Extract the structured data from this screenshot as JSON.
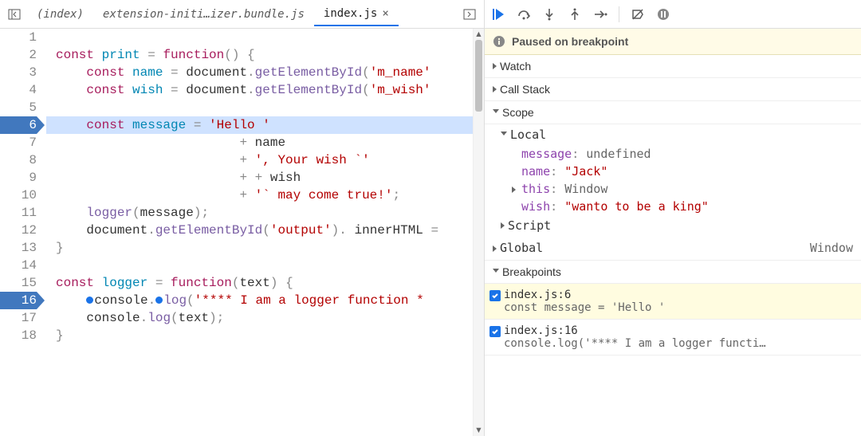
{
  "tabs": {
    "sidebar_toggle_icon": "panel-left-icon",
    "items": [
      {
        "label": "(index)",
        "active": false
      },
      {
        "label": "extension-initi…izer.bundle.js",
        "active": false
      },
      {
        "label": "index.js",
        "active": true
      }
    ],
    "more_tabs_icon": "chevron-right-icon"
  },
  "code": {
    "lines": [
      {
        "n": 1,
        "seg": []
      },
      {
        "n": 2,
        "seg": [
          [
            "kw",
            "const "
          ],
          [
            "var",
            "print"
          ],
          [
            "punct",
            " = "
          ],
          [
            "kw",
            "function"
          ],
          [
            "punct",
            "() {"
          ]
        ]
      },
      {
        "n": 3,
        "seg": [
          [
            "",
            "    "
          ],
          [
            "kw",
            "const "
          ],
          [
            "var",
            "name"
          ],
          [
            "punct",
            " = "
          ],
          [
            "ident",
            "document"
          ],
          [
            "punct",
            "."
          ],
          [
            "fn",
            "getElementById"
          ],
          [
            "punct",
            "("
          ],
          [
            "str",
            "'m_name'"
          ]
        ]
      },
      {
        "n": 4,
        "seg": [
          [
            "",
            "    "
          ],
          [
            "kw",
            "const "
          ],
          [
            "var",
            "wish"
          ],
          [
            "punct",
            " = "
          ],
          [
            "ident",
            "document"
          ],
          [
            "punct",
            "."
          ],
          [
            "fn",
            "getElementById"
          ],
          [
            "punct",
            "("
          ],
          [
            "str",
            "'m_wish'"
          ]
        ]
      },
      {
        "n": 5,
        "seg": []
      },
      {
        "n": 6,
        "bp": true,
        "current": true,
        "seg": [
          [
            "",
            "    "
          ],
          [
            "kw",
            "const "
          ],
          [
            "var",
            "message"
          ],
          [
            "punct",
            " = "
          ],
          [
            "str",
            "'Hello '"
          ]
        ]
      },
      {
        "n": 7,
        "seg": [
          [
            "",
            "                        "
          ],
          [
            "punct",
            "+ "
          ],
          [
            "ident",
            "name"
          ]
        ]
      },
      {
        "n": 8,
        "seg": [
          [
            "",
            "                        "
          ],
          [
            "punct",
            "+ "
          ],
          [
            "str",
            "', Your wish `'"
          ]
        ]
      },
      {
        "n": 9,
        "seg": [
          [
            "",
            "                        "
          ],
          [
            "punct",
            "+ + "
          ],
          [
            "ident",
            "wish"
          ]
        ]
      },
      {
        "n": 10,
        "seg": [
          [
            "",
            "                        "
          ],
          [
            "punct",
            "+ "
          ],
          [
            "str",
            "'` may come true!'"
          ],
          [
            "punct",
            ";"
          ]
        ]
      },
      {
        "n": 11,
        "seg": [
          [
            "",
            "    "
          ],
          [
            "fn",
            "logger"
          ],
          [
            "punct",
            "("
          ],
          [
            "ident",
            "message"
          ],
          [
            "punct",
            ");"
          ]
        ]
      },
      {
        "n": 12,
        "seg": [
          [
            "",
            "    "
          ],
          [
            "ident",
            "document"
          ],
          [
            "punct",
            "."
          ],
          [
            "fn",
            "getElementById"
          ],
          [
            "punct",
            "("
          ],
          [
            "str",
            "'output'"
          ],
          [
            "punct",
            "). "
          ],
          [
            "ident",
            "innerHTML"
          ],
          [
            "punct",
            " ="
          ]
        ]
      },
      {
        "n": 13,
        "seg": [
          [
            "punct",
            "}"
          ]
        ]
      },
      {
        "n": 14,
        "seg": []
      },
      {
        "n": 15,
        "seg": [
          [
            "kw",
            "const "
          ],
          [
            "var",
            "logger"
          ],
          [
            "punct",
            " = "
          ],
          [
            "kw",
            "function"
          ],
          [
            "punct",
            "("
          ],
          [
            "ident",
            "text"
          ],
          [
            "punct",
            ") {"
          ]
        ]
      },
      {
        "n": 16,
        "bp": true,
        "seg": [
          [
            "",
            "    "
          ],
          [
            "bpdot",
            ""
          ],
          [
            "ident",
            "console"
          ],
          [
            "punct",
            "."
          ],
          [
            "bpdot",
            ""
          ],
          [
            "fn",
            "log"
          ],
          [
            "punct",
            "("
          ],
          [
            "str",
            "'**** I am a logger function *"
          ]
        ]
      },
      {
        "n": 17,
        "seg": [
          [
            "",
            "    "
          ],
          [
            "ident",
            "console"
          ],
          [
            "punct",
            "."
          ],
          [
            "fn",
            "log"
          ],
          [
            "punct",
            "("
          ],
          [
            "ident",
            "text"
          ],
          [
            "punct",
            ");"
          ]
        ]
      },
      {
        "n": 18,
        "seg": [
          [
            "punct",
            "}"
          ]
        ]
      }
    ]
  },
  "debug_toolbar": {
    "buttons": [
      "resume",
      "step-over",
      "step-into",
      "step-out",
      "step",
      "deactivate-breakpoints",
      "pause"
    ]
  },
  "paused_banner": "Paused on breakpoint",
  "panels": {
    "watch": "Watch",
    "callstack": "Call Stack",
    "scope": {
      "title": "Scope",
      "local": {
        "title": "Local",
        "vars": [
          {
            "name": "message",
            "value": "undefined",
            "type": "undef"
          },
          {
            "name": "name",
            "value": "\"Jack\"",
            "type": "str"
          },
          {
            "name": "this",
            "value": "Window",
            "type": "obj",
            "expandable": true
          },
          {
            "name": "wish",
            "value": "\"wanto to be a king\"",
            "type": "str"
          }
        ]
      },
      "script": "Script",
      "global": {
        "label": "Global",
        "value": "Window"
      }
    },
    "breakpoints": {
      "title": "Breakpoints",
      "items": [
        {
          "loc": "index.js:6",
          "code": "const message = 'Hello '",
          "active": true
        },
        {
          "loc": "index.js:16",
          "code": "console.log('**** I am a logger functi…",
          "active": false
        }
      ]
    }
  }
}
